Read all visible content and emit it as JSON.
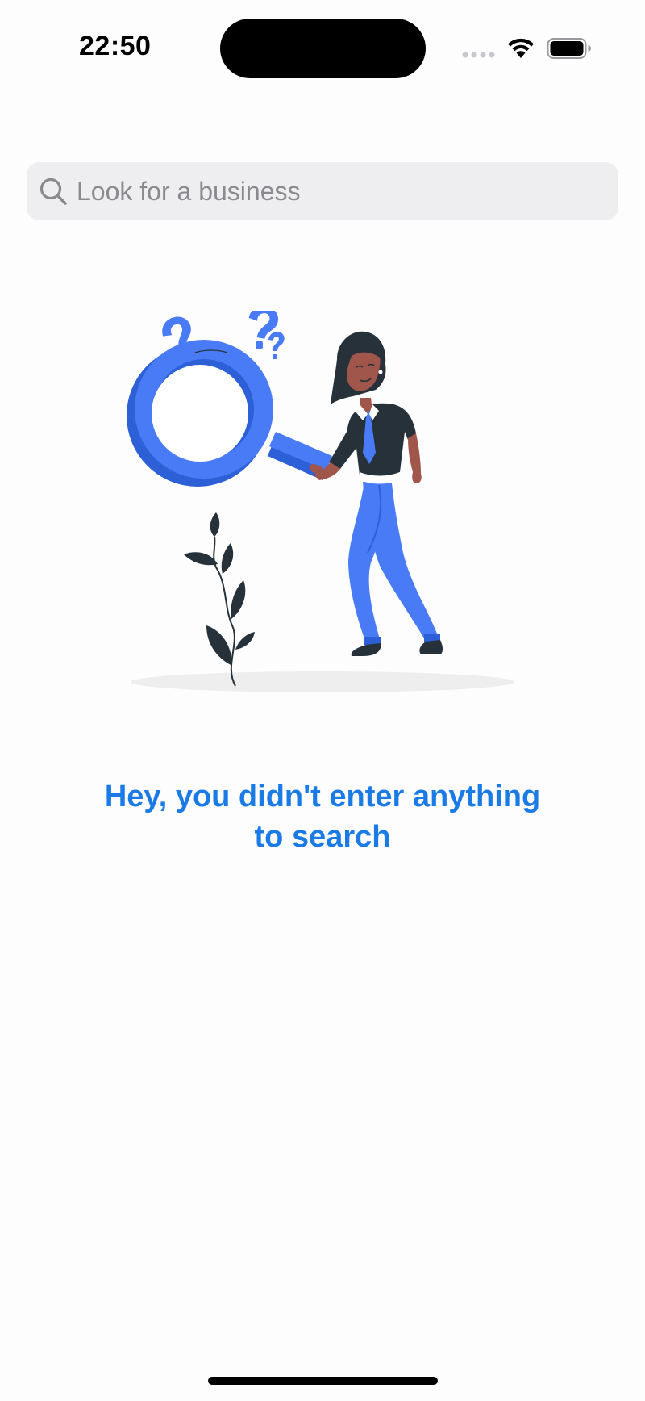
{
  "status_bar": {
    "time": "22:50"
  },
  "search": {
    "placeholder": "Look for a business",
    "value": "",
    "icon": "search-icon"
  },
  "illustration": {
    "icon": "person-with-magnifier-illustration"
  },
  "empty_state": {
    "message_line1": "Hey, you didn't enter anything",
    "message_line2": "to search"
  },
  "colors": {
    "accent": "#1b7be6",
    "illustration_blue": "#4a7bf7",
    "search_bg": "#eeeef0",
    "placeholder": "#8a8a8e"
  }
}
